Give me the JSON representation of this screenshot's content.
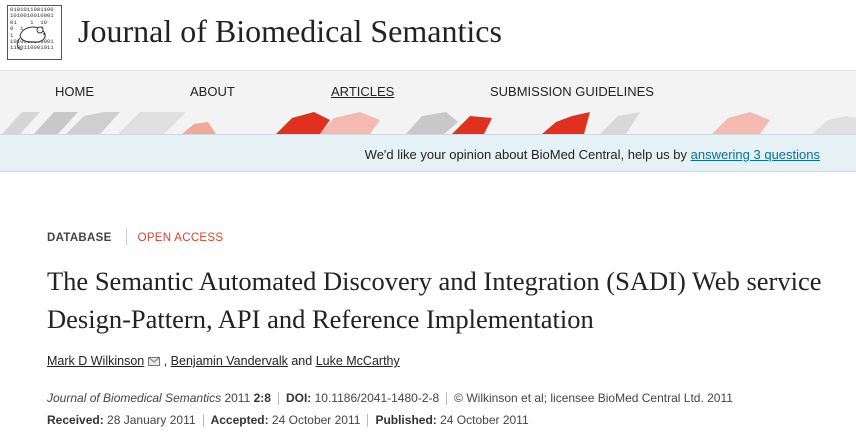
{
  "header": {
    "journal_title": "Journal of Biomedical Semantics",
    "logo_bits": "0101011001100\n1010010010001\n01    1  10\n0  1     0\n1      110\n1010010100001\n1100110001011"
  },
  "nav": {
    "items": [
      {
        "label": "HOME"
      },
      {
        "label": "ABOUT"
      },
      {
        "label": "ARTICLES"
      },
      {
        "label": "SUBMISSION GUIDELINES"
      }
    ],
    "active": "ARTICLES"
  },
  "notice": {
    "text": "We'd like your opinion about BioMed Central, help us by ",
    "link_label": "answering 3 questions"
  },
  "article": {
    "type": "DATABASE",
    "access": "OPEN ACCESS",
    "title": "The Semantic Automated Discovery and Integration (SADI) Web service Design-Pattern, API and Reference Implementation",
    "authors": {
      "first": "Mark D Wilkinson",
      "sep1": " , ",
      "second": "Benjamin Vandervalk",
      "and": " and ",
      "third": "Luke McCarthy"
    },
    "citation": {
      "journal": "Journal of Biomedical Semantics",
      "year": "2011",
      "volume_article": "2:8",
      "doi_label": "DOI:",
      "doi": "10.1186/2041-1480-2-8",
      "copyright": "© Wilkinson et al; licensee BioMed Central Ltd. 2011"
    },
    "dates": {
      "received_label": "Received:",
      "received": "28 January 2011",
      "accepted_label": "Accepted:",
      "accepted": "24 October 2011",
      "published_label": "Published:",
      "published": "24 October 2011"
    }
  },
  "colors": {
    "accent_red": "#e2301e",
    "light_red": "#f4b9b0",
    "link_blue": "#0a6e9c",
    "notice_bg": "#e6f1f6",
    "nav_bg": "#f3f3f3"
  }
}
